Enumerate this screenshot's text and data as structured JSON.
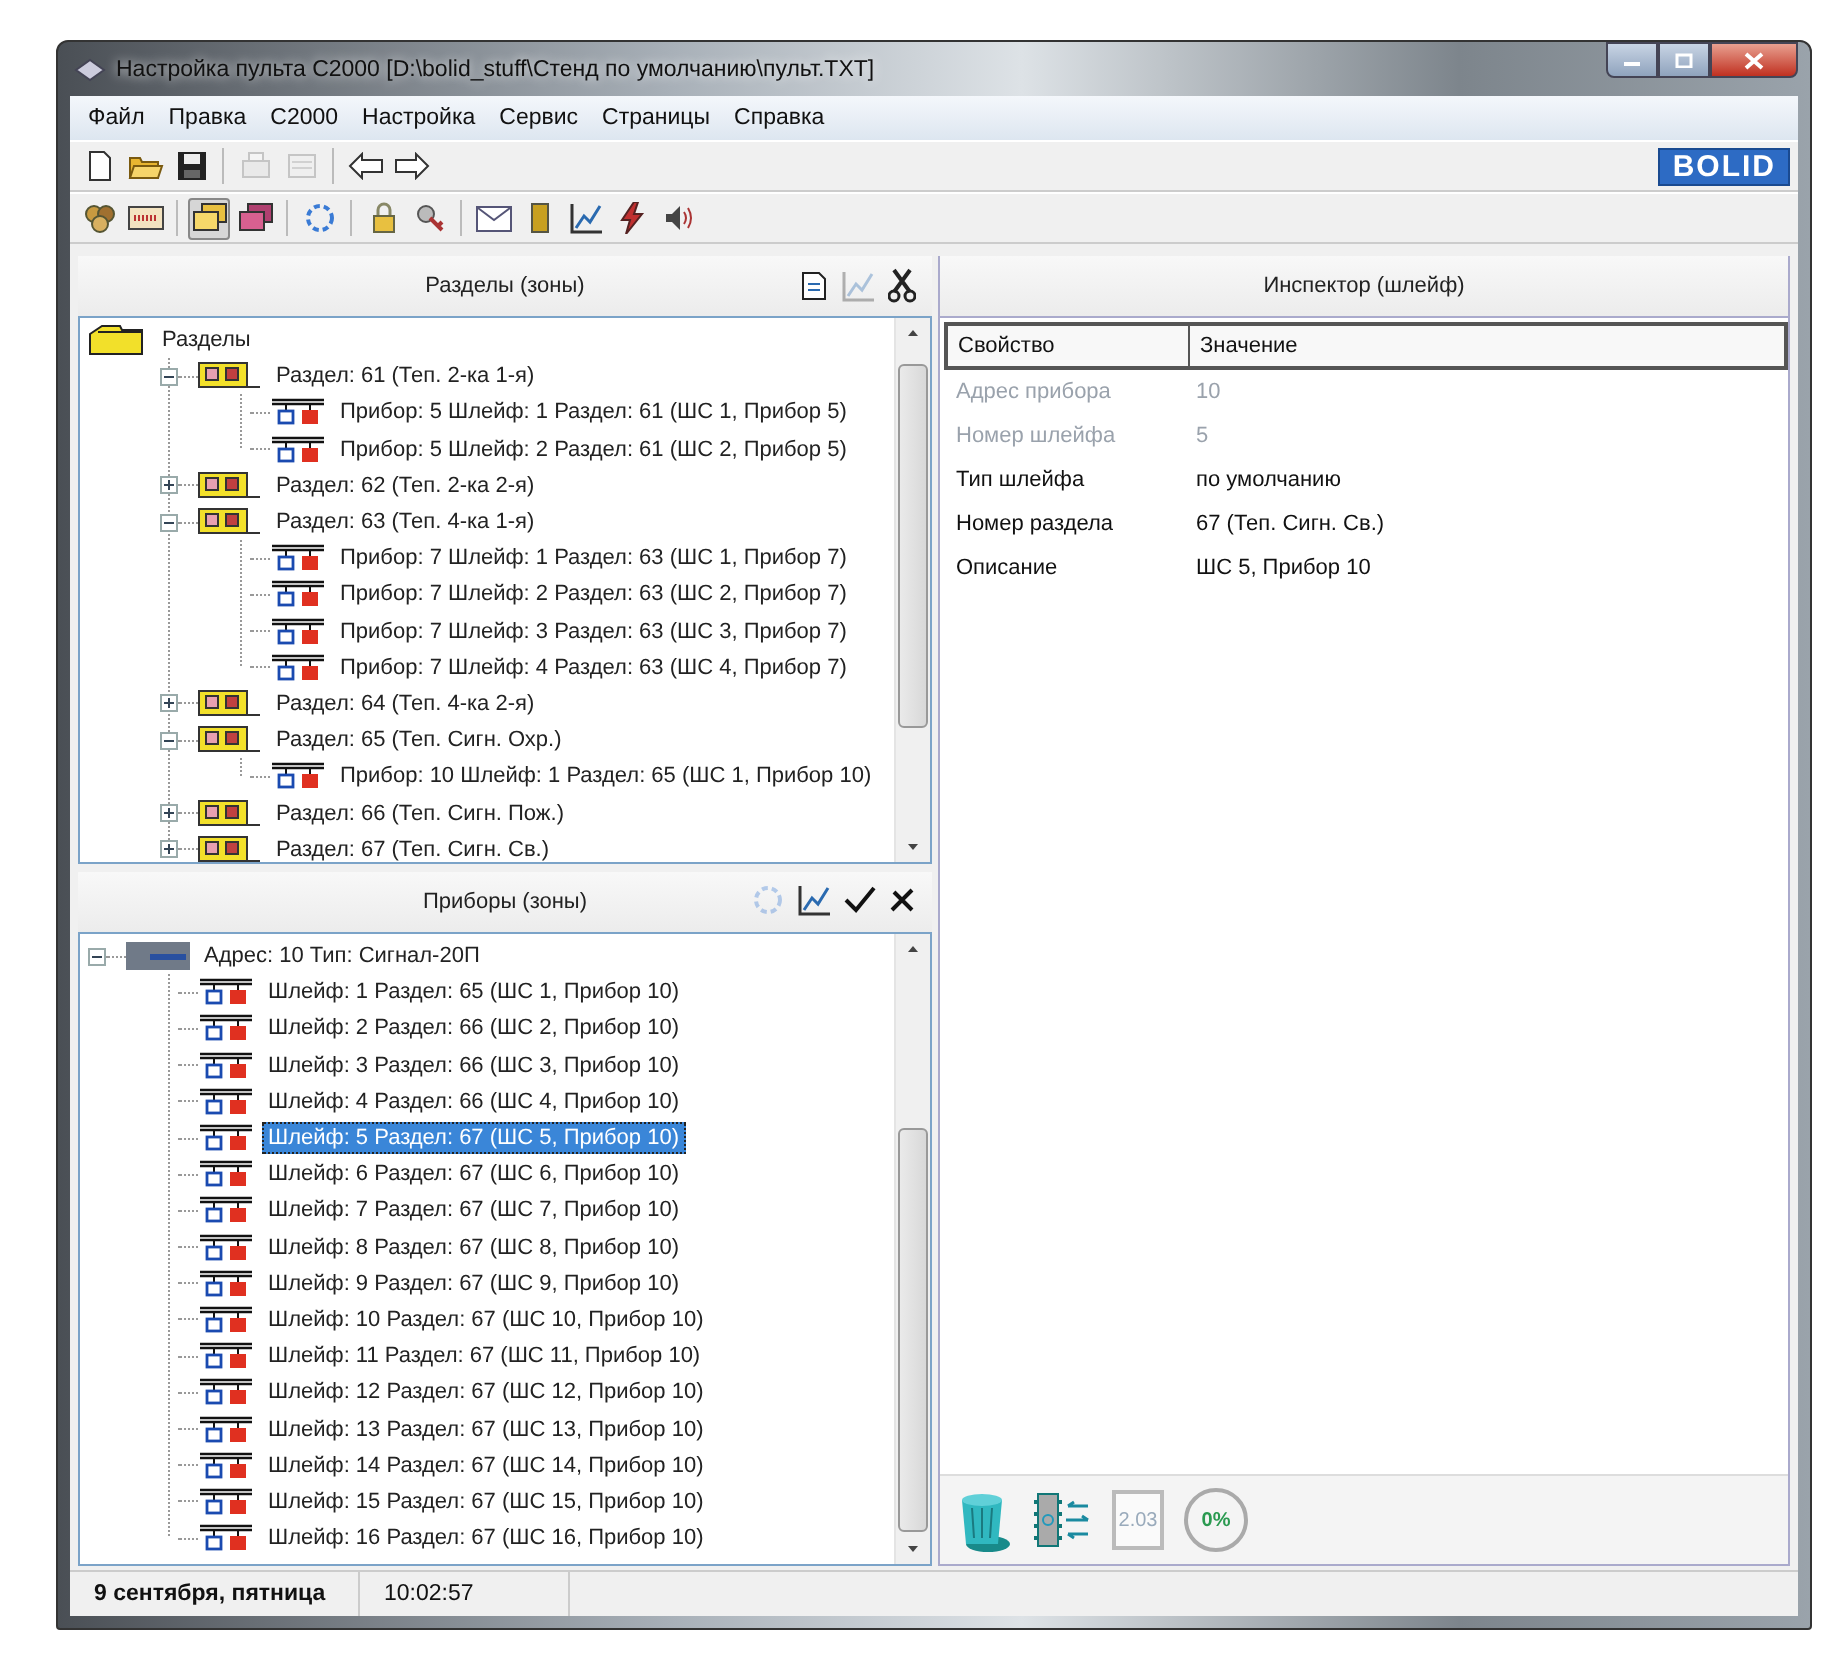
{
  "window": {
    "title": "Настройка пульта С2000 [D:\\bolid_stuff\\Стенд по умолчанию\\пульт.TXT]"
  },
  "menu": [
    "Файл",
    "Правка",
    "С2000",
    "Настройка",
    "Сервис",
    "Страницы",
    "Справка"
  ],
  "toolbar_1": [
    {
      "kind": "new",
      "disabled": false
    },
    {
      "kind": "open",
      "disabled": false
    },
    {
      "kind": "save",
      "disabled": false
    },
    {
      "kind": "print",
      "disabled": true
    },
    {
      "kind": "preview",
      "disabled": true
    },
    {
      "kind": "back",
      "disabled": false
    },
    {
      "kind": "forward",
      "disabled": false
    }
  ],
  "logo": "BOLID",
  "toolbar_2": [
    {
      "kind": "devices",
      "pressed": false
    },
    {
      "kind": "panel",
      "pressed": false
    },
    {
      "kind": "windows",
      "pressed": true
    },
    {
      "kind": "windows-red",
      "pressed": false
    },
    {
      "kind": "refresh",
      "pressed": false
    },
    {
      "kind": "lock",
      "pressed": false
    },
    {
      "kind": "keys",
      "pressed": false
    },
    {
      "kind": "envelope",
      "pressed": false
    },
    {
      "kind": "bar",
      "pressed": false
    },
    {
      "kind": "chart",
      "pressed": false
    },
    {
      "kind": "lightning",
      "pressed": false
    },
    {
      "kind": "sound",
      "pressed": false
    }
  ],
  "sections_panel": {
    "title": "Разделы (зоны)",
    "tools": [
      {
        "kind": "document",
        "disabled": false
      },
      {
        "kind": "chart",
        "disabled": true
      },
      {
        "kind": "scissors",
        "disabled": false
      }
    ],
    "tree": [
      {
        "kind": "folder",
        "label": "Разделы",
        "selected": false,
        "children": [
          {
            "kind": "section",
            "label": "Раздел: 61 (Теп. 2-ка 1-я)",
            "expanded": true,
            "selected": false,
            "children": [
              {
                "kind": "loop",
                "label": "Прибор: 5 Шлейф: 1 Раздел: 61 (ШС 1, Прибор 5)",
                "selected": false
              },
              {
                "kind": "loop",
                "label": "Прибор: 5 Шлейф: 2 Раздел: 61 (ШС 2, Прибор 5)",
                "selected": false
              }
            ]
          },
          {
            "kind": "section",
            "label": "Раздел: 62 (Теп. 2-ка 2-я)",
            "expanded": false,
            "selected": false
          },
          {
            "kind": "section",
            "label": "Раздел: 63 (Теп. 4-ка 1-я)",
            "expanded": true,
            "selected": false,
            "children": [
              {
                "kind": "loop",
                "label": "Прибор: 7 Шлейф: 1 Раздел: 63 (ШС 1, Прибор 7)",
                "selected": false
              },
              {
                "kind": "loop",
                "label": "Прибор: 7 Шлейф: 2 Раздел: 63 (ШС 2, Прибор 7)",
                "selected": false
              },
              {
                "kind": "loop",
                "label": "Прибор: 7 Шлейф: 3 Раздел: 63 (ШС 3, Прибор 7)",
                "selected": false
              },
              {
                "kind": "loop",
                "label": "Прибор: 7 Шлейф: 4 Раздел: 63 (ШС 4, Прибор 7)",
                "selected": false
              }
            ]
          },
          {
            "kind": "section",
            "label": "Раздел: 64 (Теп. 4-ка 2-я)",
            "expanded": false,
            "selected": false
          },
          {
            "kind": "section",
            "label": "Раздел: 65 (Теп. Сигн. Охр.)",
            "expanded": true,
            "selected": false,
            "children": [
              {
                "kind": "loop",
                "label": "Прибор: 10 Шлейф: 1 Раздел: 65 (ШС 1, Прибор 10)",
                "selected": false
              }
            ]
          },
          {
            "kind": "section",
            "label": "Раздел: 66 (Теп. Сигн. Пож.)",
            "expanded": false,
            "selected": false
          },
          {
            "kind": "section",
            "label": "Раздел: 67 (Теп. Сигн. Св.)",
            "expanded": false,
            "selected": false
          }
        ]
      }
    ]
  },
  "devices_panel": {
    "title": "Приборы  (зоны)",
    "tools": [
      {
        "kind": "refresh",
        "disabled": true
      },
      {
        "kind": "chart",
        "disabled": false
      },
      {
        "kind": "check",
        "disabled": false
      },
      {
        "kind": "cross",
        "disabled": false
      }
    ],
    "tree": [
      {
        "kind": "device",
        "label": "Адрес: 10 Тип: Сигнал-20П",
        "expanded": true,
        "selected": false,
        "children": [
          {
            "kind": "loop",
            "label": "Шлейф: 1 Раздел: 65 (ШС 1, Прибор 10)",
            "selected": false
          },
          {
            "kind": "loop",
            "label": "Шлейф: 2 Раздел: 66 (ШС 2, Прибор 10)",
            "selected": false
          },
          {
            "kind": "loop",
            "label": "Шлейф: 3 Раздел: 66 (ШС 3, Прибор 10)",
            "selected": false
          },
          {
            "kind": "loop",
            "label": "Шлейф: 4 Раздел: 66 (ШС 4, Прибор 10)",
            "selected": false
          },
          {
            "kind": "loop",
            "label": "Шлейф: 5 Раздел: 67 (ШС 5, Прибор 10)",
            "selected": true
          },
          {
            "kind": "loop",
            "label": "Шлейф: 6 Раздел: 67 (ШС 6, Прибор 10)",
            "selected": false
          },
          {
            "kind": "loop",
            "label": "Шлейф: 7 Раздел: 67 (ШС 7, Прибор 10)",
            "selected": false
          },
          {
            "kind": "loop",
            "label": "Шлейф: 8 Раздел: 67 (ШС 8, Прибор 10)",
            "selected": false
          },
          {
            "kind": "loop",
            "label": "Шлейф: 9 Раздел: 67 (ШС 9, Прибор 10)",
            "selected": false
          },
          {
            "kind": "loop",
            "label": "Шлейф: 10 Раздел: 67 (ШС 10, Прибор 10)",
            "selected": false
          },
          {
            "kind": "loop",
            "label": "Шлейф: 11 Раздел: 67 (ШС 11, Прибор 10)",
            "selected": false
          },
          {
            "kind": "loop",
            "label": "Шлейф: 12 Раздел: 67 (ШС 12, Прибор 10)",
            "selected": false
          },
          {
            "kind": "loop",
            "label": "Шлейф: 13 Раздел: 67 (ШС 13, Прибор 10)",
            "selected": false
          },
          {
            "kind": "loop",
            "label": "Шлейф: 14 Раздел: 67 (ШС 14, Прибор 10)",
            "selected": false
          },
          {
            "kind": "loop",
            "label": "Шлейф: 15 Раздел: 67 (ШС 15, Прибор 10)",
            "selected": false
          },
          {
            "kind": "loop",
            "label": "Шлейф: 16 Раздел: 67 (ШС 16, Прибор 10)",
            "selected": false
          }
        ]
      }
    ]
  },
  "inspector": {
    "title": "Инспектор (шлейф)",
    "columns": [
      "Свойство",
      "Значение"
    ],
    "rows": [
      {
        "property": "Адрес прибора",
        "value": "10",
        "disabled": true
      },
      {
        "property": "Номер шлейфа",
        "value": "5",
        "disabled": true
      },
      {
        "property": "Тип шлейфа",
        "value": "по умолчанию",
        "disabled": false
      },
      {
        "property": "Номер раздела",
        "value": "67 (Теп. Сигн. Св.)",
        "disabled": false
      },
      {
        "property": "Описание",
        "value": "ШС 5, Прибор 10",
        "disabled": false
      }
    ],
    "version_badge": "2.03",
    "progress_label": "0%"
  },
  "status_bar": {
    "date": "9 сентября, пятница",
    "time": "10:02:57"
  }
}
